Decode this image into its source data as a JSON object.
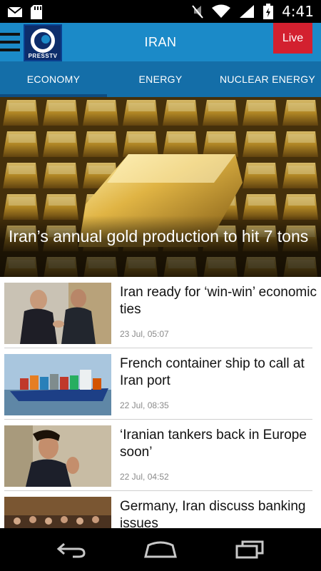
{
  "status_bar": {
    "time": "4:41",
    "icons": [
      "mail-icon",
      "sd-card-icon",
      "mute-icon",
      "wifi-icon",
      "signal-icon",
      "battery-icon"
    ]
  },
  "app_bar": {
    "title": "IRAN",
    "logo_text": "PRESSTV",
    "live_label": "Live"
  },
  "tabs": [
    {
      "label": "ECONOMY",
      "active": true
    },
    {
      "label": "ENERGY",
      "active": false
    },
    {
      "label": "NUCLEAR ENERGY",
      "active": false
    }
  ],
  "hero": {
    "title": "Iran’s annual gold production to hit 7 tons"
  },
  "news": [
    {
      "title": "Iran ready for ‘win-win’ economic ties",
      "date": "23 Jul, 05:07"
    },
    {
      "title": "French container ship to call at Iran port",
      "date": "22 Jul, 08:35"
    },
    {
      "title": "‘Iranian tankers back in Europe soon’",
      "date": "22 Jul, 04:52"
    },
    {
      "title": "Germany, Iran discuss banking issues",
      "date": ""
    }
  ],
  "colors": {
    "app_bar": "#1b8ac8",
    "tabs": "#146ea8",
    "live": "#d3202f"
  }
}
